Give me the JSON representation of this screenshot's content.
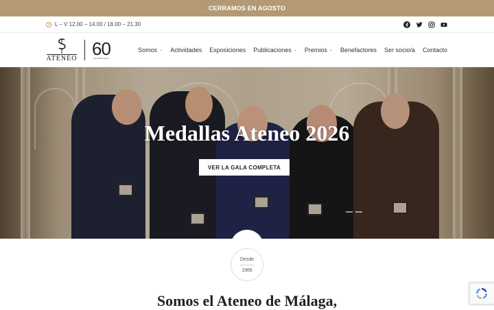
{
  "announcement": "CERRAMOS EN AGOSTO",
  "hours": "L – V 12.00 – 14.00 / 18.00 – 21.30",
  "social": [
    "facebook-icon",
    "twitter-icon",
    "instagram-icon",
    "youtube-icon"
  ],
  "logo": {
    "wordmark": "ATENEO",
    "anniversary": "60",
    "anniversary_sub": "ANIVERSARIO"
  },
  "nav": [
    {
      "label": "Somos",
      "dropdown": true
    },
    {
      "label": "Actividades",
      "dropdown": false
    },
    {
      "label": "Exposiciones",
      "dropdown": false
    },
    {
      "label": "Publicaciones",
      "dropdown": true
    },
    {
      "label": "Premios",
      "dropdown": true
    },
    {
      "label": "Benefactores",
      "dropdown": false
    },
    {
      "label": "Ser socio/a",
      "dropdown": false
    },
    {
      "label": "Contacto",
      "dropdown": false
    }
  ],
  "hero": {
    "title": "Medallas Ateneo 2026",
    "button": "VER LA GALA COMPLETA"
  },
  "since": {
    "label": "Desde",
    "year": "1966"
  },
  "section_heading": "Somos el Ateneo de Málaga,",
  "colors": {
    "accent": "#b39a74",
    "text": "#333333"
  }
}
